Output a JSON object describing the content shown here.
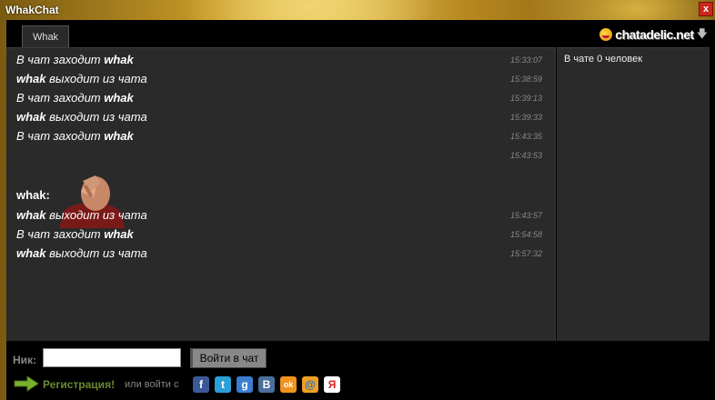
{
  "window": {
    "title": "WhakChat",
    "close_label": "x"
  },
  "tabs": [
    {
      "label": "Whak"
    }
  ],
  "brand": {
    "text": "chatadelic.net"
  },
  "sidebar": {
    "users_count": "В чате 0 человек"
  },
  "messages": [
    {
      "text_pre": "В чат заходит ",
      "user": "whak",
      "text_post": "",
      "time": "15:33:07"
    },
    {
      "text_pre": "",
      "user": "whak",
      "text_post": " выходит из чата",
      "time": "15:38:59"
    },
    {
      "text_pre": "В чат заходит ",
      "user": "whak",
      "text_post": "",
      "time": "15:39:13"
    },
    {
      "text_pre": "",
      "user": "whak",
      "text_post": " выходит из чата",
      "time": "15:39:33"
    },
    {
      "text_pre": "В чат заходит ",
      "user": "whak",
      "text_post": "",
      "time": "15:43:35"
    },
    {
      "type": "image",
      "author": "whak:",
      "time": "15:43:53"
    },
    {
      "text_pre": "",
      "user": "whak",
      "text_post": " выходит из чата",
      "time": "15:43:57"
    },
    {
      "text_pre": "В чат заходит ",
      "user": "whak",
      "text_post": "",
      "time": "15:54:58"
    },
    {
      "text_pre": "",
      "user": "whak",
      "text_post": " выходит из чата",
      "time": "15:57:32"
    }
  ],
  "login": {
    "nick_label": "Ник:",
    "nick_value": "",
    "login_button": "Войти в чат",
    "register_link": "Регистрация!",
    "or_login_with": "или войти с"
  },
  "social": [
    {
      "icon": "facebook-icon",
      "glyph": "f",
      "color": "#3b5998"
    },
    {
      "icon": "twitter-icon",
      "glyph": "t",
      "color": "#2b9fd8"
    },
    {
      "icon": "google-icon",
      "glyph": "g",
      "color": "#3a7ed0"
    },
    {
      "icon": "vk-icon",
      "glyph": "B",
      "color": "#4a6f9c"
    },
    {
      "icon": "odnoklassniki-icon",
      "glyph": "ok",
      "color": "#f0921e"
    },
    {
      "icon": "mailru-icon",
      "glyph": "@",
      "color": "#1e6fcc"
    },
    {
      "icon": "yandex-icon",
      "glyph": "Я",
      "color": "#e02020"
    }
  ]
}
